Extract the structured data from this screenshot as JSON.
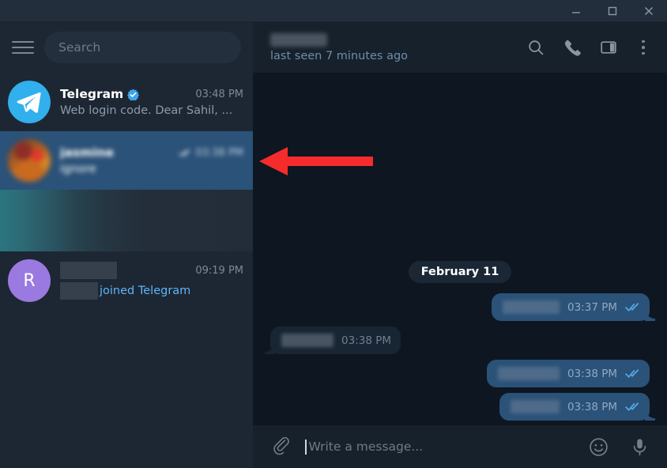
{
  "window": {
    "minimize_label": "Minimize",
    "maximize_label": "Maximize",
    "close_label": "Close"
  },
  "colors": {
    "accent": "#2b5278",
    "sidebar_bg": "#1d2733",
    "chat_bg": "#0e1621",
    "titlebar_bg": "#232e3c",
    "header_bg": "#17212b",
    "selected_row": "#2b5278",
    "link_blue": "#5eb5f7",
    "tick_blue": "#51a3e0",
    "annotation_red": "#f62c2c",
    "telegram_blue": "#32afed",
    "avatar_purple": "#9a7ae0"
  },
  "sidebar": {
    "menu_icon": "hamburger-icon",
    "search": {
      "placeholder": "Search",
      "value": ""
    },
    "chats": [
      {
        "name": "Telegram",
        "verified": true,
        "avatar_type": "telegram-logo",
        "time": "03:48 PM",
        "preview": "Web login code. Dear Sahil, ...",
        "selected": false,
        "redacted": false,
        "has_ticks": false
      },
      {
        "name": "jasmine",
        "verified": false,
        "avatar_type": "photo",
        "time": "03:38 PM",
        "preview": "ignore",
        "selected": true,
        "redacted": true,
        "has_ticks": true
      },
      {
        "name": "",
        "avatar_type": "gradient-redaction",
        "time": "",
        "preview": "",
        "selected": false,
        "redacted": true,
        "is_gradient_band": true
      },
      {
        "name": "",
        "avatar_letter": "R",
        "avatar_type": "letter",
        "time": "09:19 PM",
        "preview": "joined Telegram",
        "preview_style": "link",
        "selected": false,
        "redacted": true,
        "has_ticks": false
      }
    ]
  },
  "chat_header": {
    "peer_name": "",
    "peer_name_redacted": true,
    "status": "last seen 7 minutes ago",
    "icons": [
      {
        "name": "search-icon",
        "label": "Search messages"
      },
      {
        "name": "phone-icon",
        "label": "Call"
      },
      {
        "name": "panel-icon",
        "label": "Toggle info panel"
      },
      {
        "name": "more-menu-icon",
        "label": "More options"
      }
    ]
  },
  "conversation": {
    "date_separator": "February 11",
    "messages": [
      {
        "direction": "out",
        "text": "",
        "redacted": true,
        "redact_width": 72,
        "time": "03:37 PM",
        "status": "read",
        "tail": true
      },
      {
        "direction": "in",
        "text": "",
        "redacted": true,
        "redact_width": 66,
        "time": "03:38 PM",
        "status": "none",
        "tail": true
      },
      {
        "direction": "out",
        "text": "",
        "redacted": true,
        "redact_width": 78,
        "time": "03:38 PM",
        "status": "read",
        "tail": false
      },
      {
        "direction": "out",
        "text": "",
        "redacted": true,
        "redact_width": 62,
        "time": "03:38 PM",
        "status": "read",
        "tail": true
      }
    ]
  },
  "composer": {
    "attach_icon": "paperclip-icon",
    "placeholder": "Write a message...",
    "value": "",
    "emoji_icon": "emoji-smiley-icon",
    "voice_icon": "microphone-icon"
  },
  "annotation": {
    "type": "arrow",
    "direction": "left",
    "color": "#f62c2c",
    "points_to": "selected-chat-row"
  }
}
